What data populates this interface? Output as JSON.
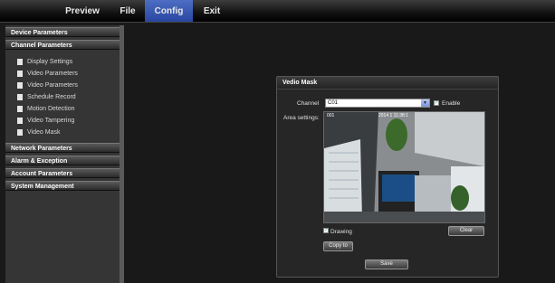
{
  "topbar": {
    "menus": [
      {
        "label": "Preview"
      },
      {
        "label": "File"
      },
      {
        "label": "Config"
      },
      {
        "label": "Exit"
      }
    ]
  },
  "sidebar": {
    "device_parameters": "Device Parameters",
    "channel_parameters": "Channel Parameters",
    "channel_items": [
      "Display Settings",
      "Video Parameters",
      "Video Parameters",
      "Schedule Record",
      "Motion Detection",
      "Video Tampering",
      "Video Mask"
    ],
    "network_parameters": "Network Parameters",
    "alarm_exception": "Alarm & Exception",
    "account_parameters": "Account Parameters",
    "system_management": "System Management"
  },
  "dialog": {
    "title": "Vedio Mask",
    "channel_label": "Channel",
    "channel_value": "C01",
    "enable_label": "Enable",
    "area_label": "Area settings:",
    "video_channel_text": "001",
    "video_timestamp": "2014 1 11:38:1",
    "drawing_label": "Drawing",
    "clear_label": "Clear",
    "copy_label": "Copy to",
    "save_label": "Save"
  }
}
